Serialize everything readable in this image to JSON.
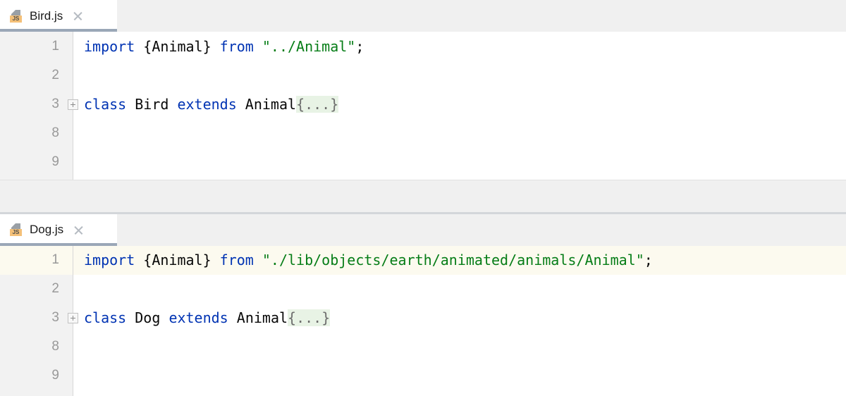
{
  "editors": [
    {
      "tab": {
        "label": "Bird.js",
        "icon": "js-file-icon",
        "badge": "JS",
        "close_icon": "close-icon"
      },
      "lines": [
        {
          "number": "1",
          "current": false,
          "fold_marker": false,
          "tokens": [
            {
              "type": "kw",
              "text": "import"
            },
            {
              "type": "plain",
              "text": " {Animal} "
            },
            {
              "type": "kw",
              "text": "from"
            },
            {
              "type": "plain",
              "text": " "
            },
            {
              "type": "str",
              "text": "\"../Animal\""
            },
            {
              "type": "plain",
              "text": ";"
            }
          ]
        },
        {
          "number": "2",
          "current": false,
          "fold_marker": false,
          "tokens": []
        },
        {
          "number": "3",
          "current": false,
          "fold_marker": true,
          "tokens": [
            {
              "type": "kw",
              "text": "class"
            },
            {
              "type": "plain",
              "text": " Bird "
            },
            {
              "type": "kw",
              "text": "extends"
            },
            {
              "type": "plain",
              "text": " Animal"
            },
            {
              "type": "fold",
              "text": "{...}"
            }
          ]
        },
        {
          "number": "8",
          "current": false,
          "fold_marker": false,
          "tokens": []
        },
        {
          "number": "9",
          "current": false,
          "fold_marker": false,
          "tokens": []
        }
      ]
    },
    {
      "tab": {
        "label": "Dog.js",
        "icon": "js-file-icon",
        "badge": "JS",
        "close_icon": "close-icon"
      },
      "lines": [
        {
          "number": "1",
          "current": true,
          "fold_marker": false,
          "tokens": [
            {
              "type": "kw",
              "text": "import"
            },
            {
              "type": "plain",
              "text": " {Animal} "
            },
            {
              "type": "kw",
              "text": "from"
            },
            {
              "type": "plain",
              "text": " "
            },
            {
              "type": "str",
              "text": "\"./lib/objects/earth/animated/animals/Animal\""
            },
            {
              "type": "plain",
              "text": ";"
            }
          ]
        },
        {
          "number": "2",
          "current": false,
          "fold_marker": false,
          "tokens": []
        },
        {
          "number": "3",
          "current": false,
          "fold_marker": true,
          "tokens": [
            {
              "type": "kw",
              "text": "class"
            },
            {
              "type": "plain",
              "text": " Dog "
            },
            {
              "type": "kw",
              "text": "extends"
            },
            {
              "type": "plain",
              "text": " Animal"
            },
            {
              "type": "fold",
              "text": "{...}"
            }
          ]
        },
        {
          "number": "8",
          "current": false,
          "fold_marker": false,
          "tokens": []
        },
        {
          "number": "9",
          "current": false,
          "fold_marker": false,
          "tokens": []
        }
      ]
    }
  ],
  "colors": {
    "keyword": "#0033b3",
    "string": "#067d17",
    "text": "#080808",
    "folded_bg": "#e8f3e5",
    "current_line_bg": "#fcfaef",
    "gutter_bg": "#f2f2f2",
    "tab_underline": "#9aa7b7",
    "js_badge": "#f4c078"
  }
}
